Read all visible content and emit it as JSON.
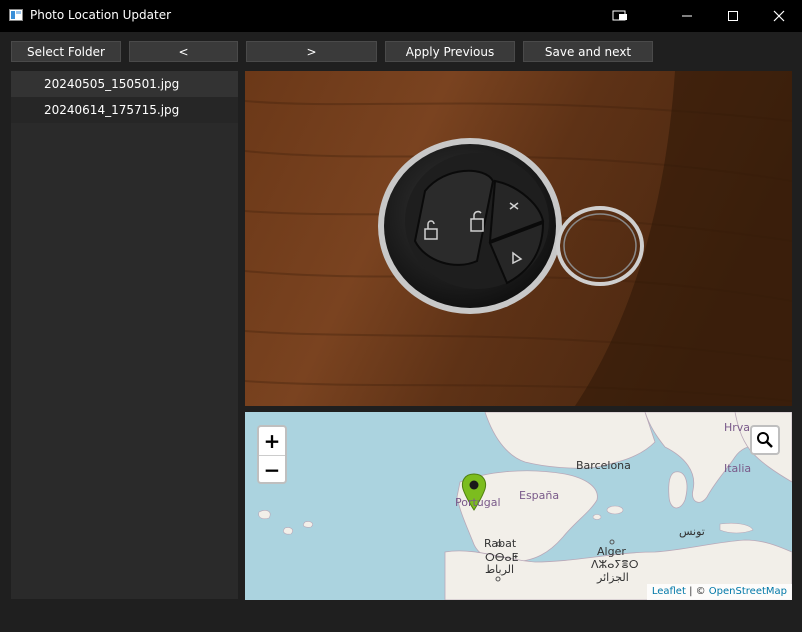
{
  "window": {
    "title": "Photo Location Updater",
    "controls": [
      "tablet-mode",
      "minimize",
      "maximize",
      "close"
    ]
  },
  "toolbar": {
    "select_folder": "Select Folder",
    "prev": "<",
    "next": ">",
    "apply_previous": "Apply Previous",
    "save_next": "Save and next"
  },
  "files": [
    {
      "name": "20240505_150501.jpg"
    },
    {
      "name": "20240614_175715.jpg"
    }
  ],
  "map": {
    "zoom_in": "+",
    "zoom_out": "−",
    "labels": {
      "barcelona": "Barcelona",
      "espana": "España",
      "portugal": "Portugal",
      "italia": "Italia",
      "hrva": "Hrva",
      "rabat": "Rabat",
      "rabat_tif": "ⵔⴱⴰⵟ",
      "rabat_ar": "الرباط",
      "alger": "Alger",
      "alger_tif": "ⴷⵣⴰⵢⴻⵔ",
      "alger_ar": "الجزائر",
      "tunis_ar": "تونس"
    },
    "attribution_leaflet": "Leaflet",
    "attribution_sep": " | © ",
    "attribution_osm": "OpenStreetMap",
    "marker_color": "#7cbd1e",
    "water_color": "#abd3df",
    "land_color": "#f2efe9"
  },
  "photo": {
    "subject": "car key fob with ring on wooden surface"
  }
}
